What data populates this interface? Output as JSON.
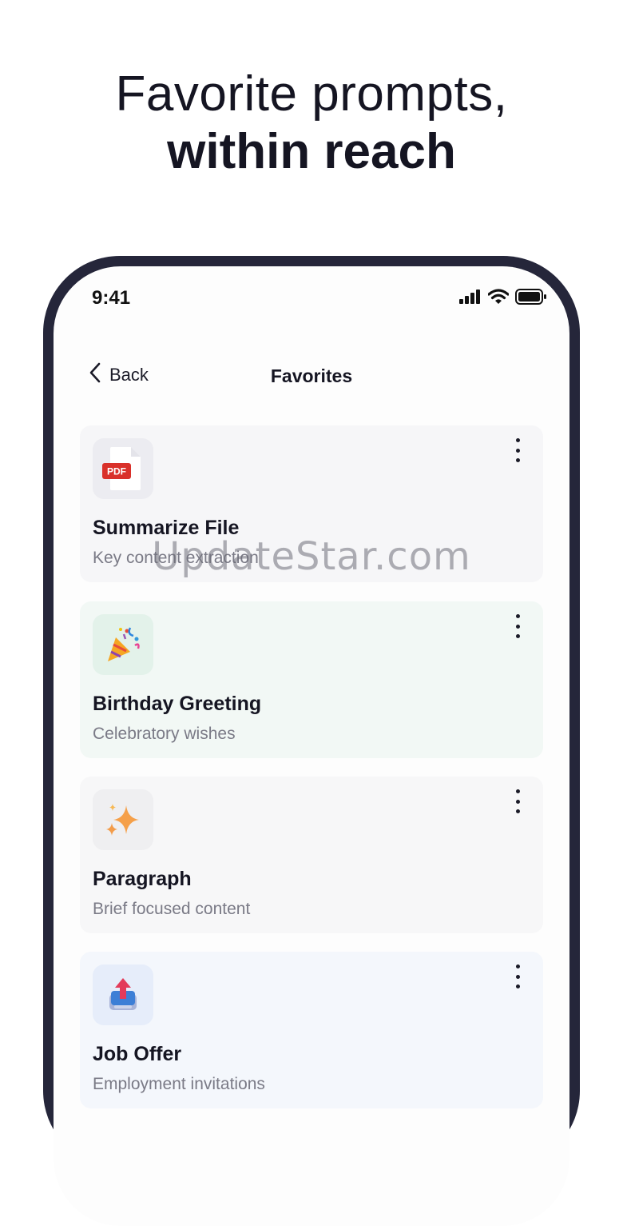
{
  "headline": {
    "line1": "Favorite prompts,",
    "line2": "within reach"
  },
  "status_bar": {
    "time": "9:41",
    "icons": [
      "cellular-signal-icon",
      "wifi-icon",
      "battery-icon"
    ]
  },
  "nav": {
    "back_label": "Back",
    "title": "Favorites"
  },
  "favorites": [
    {
      "title": "Summarize File",
      "subtitle": "Key content extraction",
      "icon": "pdf-file-icon",
      "card_color": "#f6f6f8",
      "icon_bg": "#ececf1",
      "icon_label": "PDF"
    },
    {
      "title": "Birthday Greeting",
      "subtitle": "Celebratory wishes",
      "icon": "party-popper-icon",
      "card_color": "#f2f8f5",
      "icon_bg": "#e3f2ea"
    },
    {
      "title": "Paragraph",
      "subtitle": "Brief focused content",
      "icon": "sparkles-icon",
      "card_color": "#f7f7f8",
      "icon_bg": "#efeff1"
    },
    {
      "title": "Job Offer",
      "subtitle": "Employment invitations",
      "icon": "inbox-upload-icon",
      "card_color": "#f4f7fc",
      "icon_bg": "#e6edfa"
    }
  ],
  "watermark": "UpdateStar.com",
  "colors": {
    "frame": "#25263a",
    "text": "#151522",
    "muted": "#7a7a86"
  }
}
